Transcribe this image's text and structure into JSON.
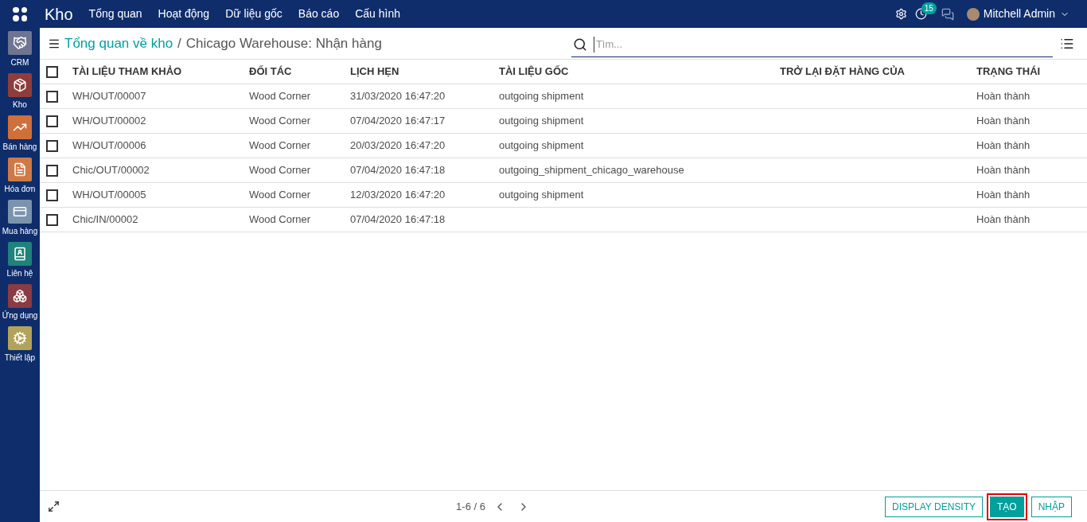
{
  "topbar": {
    "app_title": "Kho",
    "menu": [
      "Tổng quan",
      "Hoạt động",
      "Dữ liệu gốc",
      "Báo cáo",
      "Cấu hình"
    ],
    "activity_count": "15",
    "user": "Mitchell Admin"
  },
  "sidebar": {
    "items": [
      {
        "label": "CRM",
        "color": "#6f7590",
        "kind": "handshake"
      },
      {
        "label": "Kho",
        "color": "#8e3d3d",
        "kind": "box"
      },
      {
        "label": "Bán hàng",
        "color": "#cf6f3a",
        "kind": "chart"
      },
      {
        "label": "Hóa đơn",
        "color": "#cf7a46",
        "kind": "invoice"
      },
      {
        "label": "Mua hàng",
        "color": "#7c93ae",
        "kind": "card"
      },
      {
        "label": "Liên hệ",
        "color": "#1f827c",
        "kind": "contact"
      },
      {
        "label": "Ứng dụng",
        "color": "#8a3b43",
        "kind": "cubes"
      },
      {
        "label": "Thiết lập",
        "color": "#b3a25a",
        "kind": "gear"
      }
    ]
  },
  "breadcrumb": {
    "parent": "Tổng quan về kho",
    "separator": "/",
    "current": "Chicago Warehouse: Nhận hàng"
  },
  "search": {
    "placeholder": "Tìm..."
  },
  "table": {
    "columns": [
      "TÀI LIỆU THAM KHẢO",
      "ĐỐI TÁC",
      "LỊCH HẸN",
      "TÀI LIỆU GỐC",
      "TRỞ LẠI ĐẶT HÀNG CỦA",
      "TRẠNG THÁI"
    ],
    "select_all_checked": false,
    "rows": [
      {
        "checked": false,
        "cells": [
          "WH/OUT/00007",
          "Wood Corner",
          "31/03/2020 16:47:20",
          "outgoing shipment",
          "",
          "Hoàn thành"
        ]
      },
      {
        "checked": false,
        "cells": [
          "WH/OUT/00002",
          "Wood Corner",
          "07/04/2020 16:47:17",
          "outgoing shipment",
          "",
          "Hoàn thành"
        ]
      },
      {
        "checked": false,
        "cells": [
          "WH/OUT/00006",
          "Wood Corner",
          "20/03/2020 16:47:20",
          "outgoing shipment",
          "",
          "Hoàn thành"
        ]
      },
      {
        "checked": false,
        "cells": [
          "Chic/OUT/00002",
          "Wood Corner",
          "07/04/2020 16:47:18",
          "outgoing_shipment_chicago_warehouse",
          "",
          "Hoàn thành"
        ]
      },
      {
        "checked": false,
        "cells": [
          "WH/OUT/00005",
          "Wood Corner",
          "12/03/2020 16:47:20",
          "outgoing shipment",
          "",
          "Hoàn thành"
        ]
      },
      {
        "checked": false,
        "cells": [
          "Chic/IN/00002",
          "Wood Corner",
          "07/04/2020 16:47:18",
          "",
          "",
          "Hoàn thành"
        ]
      }
    ]
  },
  "footer": {
    "pager": "1-6 / 6",
    "buttons": [
      {
        "label": "DISPLAY DENSITY",
        "kind": "outline",
        "highlighted": false
      },
      {
        "label": "TẠO",
        "kind": "primary",
        "highlighted": true
      },
      {
        "label": "NHẬP",
        "kind": "outline",
        "highlighted": false
      }
    ]
  }
}
